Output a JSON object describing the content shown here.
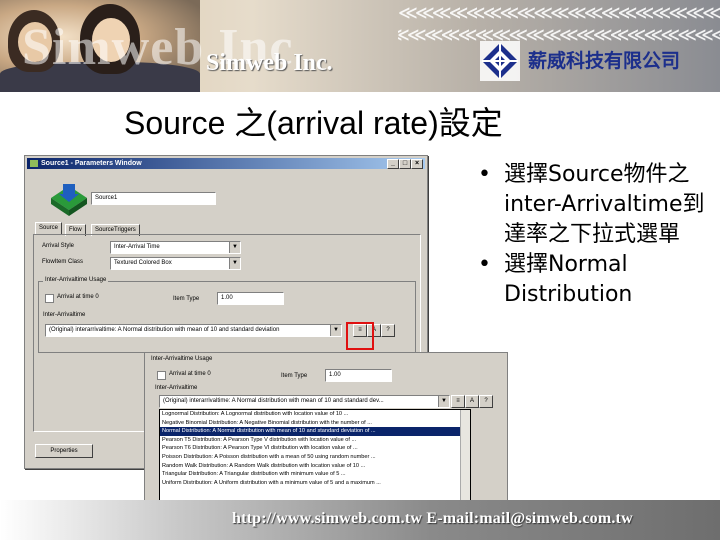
{
  "header": {
    "logo_big": "Simweb Inc",
    "logo_small": "Simweb Inc.",
    "chevrons": "≪≪≪≪≪≪≪≪≪≪≪≪≪≪≪≪≪≪≪≪≪≪≪≪≪≪≪≪≪≪≪≪≪≪≪≪≪≪≪≪",
    "company_name": "薪威科技有限公司"
  },
  "slide": {
    "title": "Source 之(arrival rate)設定"
  },
  "window1": {
    "title": "Source1 - Parameters Window",
    "name_value": "Source1",
    "tabs": [
      "Source",
      "Flow",
      "SourceTriggers"
    ],
    "arrival_style_label": "Arrival Style",
    "arrival_style_value": "Inter-Arrival Time",
    "flowitem_class_label": "FlowItem Class",
    "flowitem_class_value": "Textured Colored Box",
    "group_label": "Inter-Arrivaltime Usage",
    "arrival_at_time0": "Arrival at time 0",
    "item_type_label": "Item Type",
    "item_type_value": "1.00",
    "interarrival_label": "Inter-Arrivaltime",
    "interarrival_value": "(Original) interarrivaltime: A Normal distribution with mean of 10 and standard deviation",
    "properties_button": "Properties"
  },
  "window2": {
    "group_label": "Inter-Arrivaltime Usage",
    "arrival_at_time0": "Arrival at time 0",
    "item_type_label": "Item Type",
    "item_type_value": "1.00",
    "interarrival_label": "Inter-Arrivaltime",
    "interarrival_value": "(Original) interarrivaltime: A Normal distribution with mean of 10 and standard dev...",
    "list_items": [
      "Lognormal Distribution:  A Lognormal distribution with location value of 10 ...",
      "Negative Binomial Distribution:  A Negative Binomial distribution with the number of ...",
      "Normal Distribution:  A Normal distribution with mean of 10 and standard deviation of ...",
      "Pearson T5 Distribution:  A Pearson Type V distribution with location value of ...",
      "Pearson T6 Distribution:  A Pearson Type VI distribution with location value of ...",
      "Poisson Distribution:  A Poisson distribution with a mean of 50 using random number ...",
      "Random Walk Distribution:  A Random Walk distribution with location value of 10 ...",
      "Triangular Distribution:  A Triangular distribution with minimum value of 5 ...",
      "Uniform Distribution:  A Uniform distribution with a minimum value of 5 and a maximum ..."
    ],
    "selected_index": 2
  },
  "bullets": [
    "選擇Source物件之inter-Arrivaltime到達率之下拉式選單",
    "選擇Normal Distribution"
  ],
  "footer": {
    "text": "http://www.simweb.com.tw   E-mail:mail@simweb.com.tw"
  },
  "colors": {
    "highlight_box": "#e01010",
    "company_blue": "#1c2f8c"
  }
}
